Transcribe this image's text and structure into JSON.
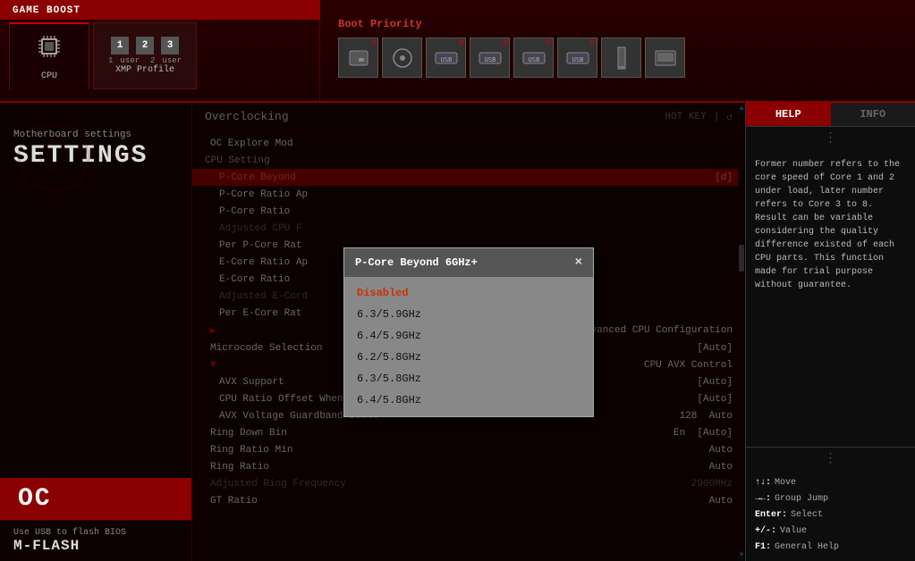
{
  "topBar": {
    "gameBoost": "GAME BOOST",
    "tabs": [
      {
        "id": "cpu",
        "label": "CPU",
        "icon": "🖥"
      },
      {
        "id": "xmp",
        "label": "XMP Profile",
        "icon": "🔲",
        "numbers": [
          "1",
          "2",
          "3"
        ],
        "users": [
          "1 user",
          "2 user"
        ]
      }
    ],
    "bootPriority": {
      "label": "Boot Priority",
      "devices": [
        {
          "icon": "💾",
          "badge": "U"
        },
        {
          "icon": "💿",
          "badge": ""
        },
        {
          "icon": "🔌",
          "label": "USB",
          "badge": "U"
        },
        {
          "icon": "🔌",
          "label": "USB",
          "badge": "U"
        },
        {
          "icon": "🔌",
          "label": "USB",
          "badge": "U"
        },
        {
          "icon": "🔌",
          "label": "USB",
          "badge": "U"
        },
        {
          "icon": "🔲",
          "badge": ""
        },
        {
          "icon": "📄",
          "badge": ""
        }
      ]
    }
  },
  "sidebar": {
    "settingsLabel": "Motherboard settings",
    "settingsTitle": "SETTINGS",
    "ocLabel": "OC",
    "mflashLabel": "Use USB to flash BIOS",
    "mflashTitle": "M-FLASH"
  },
  "overclocking": {
    "title": "Overclocking",
    "hotkeyLabel": "HOT KEY",
    "ocExploreModeLabel": "OC Explore Mod",
    "ocExploreModeValue": "",
    "cpuSettingLabel": "CPU Setting",
    "pCoreBeyondLabel": "P-Core Beyond",
    "pCoreBeyondValue": "[d]",
    "pCoreRatioApLabel": "P-Core Ratio Ap",
    "pCoreRatioApValue": "",
    "pCoreRatioLabel": "P-Core Ratio",
    "pCoreRatioValue": "",
    "adjustedCpuLabel": "Adjusted CPU F",
    "perPCoreRatLabel": "Per P-Core Rat",
    "perPCoreRatValue": "",
    "eCoreRatioApLabel": "E-Core Ratio Ap",
    "eCoreRatioApValue": "",
    "eCoreRatioLabel": "E-Core Ratio",
    "adjustedECoreLabel": "Adjusted E-Cord",
    "perECoreRatLabel": "Per E-Core Rat",
    "advancedCpuLabel": "Advanced CPU Configuration",
    "microcodeLabel": "Microcode Selection",
    "microcodeValue": "[Auto]",
    "cpuAvxLabel": "CPU AVX Control",
    "avxSupportLabel": "AVX Support",
    "avxSupportValue": "[Auto]",
    "cpuRatioOffsetLabel": "CPU Ratio Offset When Running AVX",
    "cpuRatioOffsetValue": "[Auto]",
    "avxVoltageLabel": "AVX Voltage Guardband Scale",
    "avxVoltageNum": "128",
    "avxVoltageValue": "Auto",
    "ringDownBinLabel": "Ring Down Bin",
    "ringDownBinMid": "En",
    "ringDownBinValue": "[Auto]",
    "ringRatioMinLabel": "Ring Ratio Min",
    "ringRatioMinValue": "Auto",
    "ringRatioLabel": "Ring Ratio",
    "ringRatioValue": "Auto",
    "adjustedRingLabel": "Adjusted Ring Frequency",
    "adjustedRingValue": "2900MHz",
    "gtRatioLabel": "GT Ratio",
    "gtRatioValue": "Auto"
  },
  "helpPanel": {
    "helpLabel": "HELP",
    "infoLabel": "INFO",
    "content": "Former number refers to the core speed of Core 1 and 2 under load, later number refers to Core 3 to 8. Result can be variable considering the quality difference existed of each CPU parts. This function made for trial purpose without guarantee.",
    "keys": [
      {
        "key": "↑↓:",
        "desc": "Move"
      },
      {
        "key": "→←:",
        "desc": "Group Jump"
      },
      {
        "key": "Enter:",
        "desc": "Select"
      },
      {
        "key": "+/-:",
        "desc": "Value"
      },
      {
        "key": "F1:",
        "desc": "General Help"
      }
    ]
  },
  "modal": {
    "title": "P-Core Beyond 6GHz+",
    "closeLabel": "×",
    "options": [
      {
        "label": "Disabled",
        "selected": true
      },
      {
        "label": "6.3/5.9GHz",
        "selected": false
      },
      {
        "label": "6.4/5.9GHz",
        "selected": false
      },
      {
        "label": "6.2/5.8GHz",
        "selected": false
      },
      {
        "label": "6.3/5.8GHz",
        "selected": false
      },
      {
        "label": "6.4/5.8GHz",
        "selected": false
      }
    ]
  }
}
